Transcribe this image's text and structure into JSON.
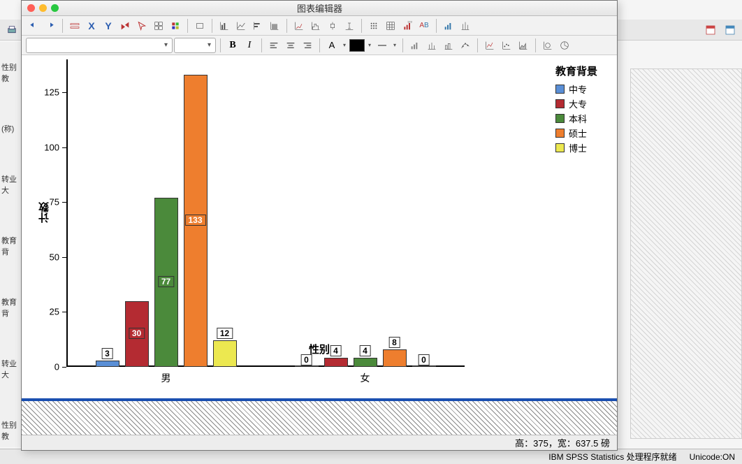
{
  "window_title": "图表编辑器",
  "bg_side_items": [
    "性别 教",
    "(称)",
    "转业大",
    "教育背",
    "教育背",
    "转业大",
    "性别 教"
  ],
  "bg_status": {
    "ready": "IBM SPSS Statistics 处理程序就绪",
    "unicode": "Unicode:ON"
  },
  "dim_text": "高：375，宽：637.5 磅",
  "toolbar": {
    "X": "X",
    "Y": "Y",
    "B": "B",
    "I": "I",
    "A": "A"
  },
  "chart_data": {
    "type": "bar",
    "title": "",
    "xlabel": "性别",
    "ylabel": "计数",
    "legend_title": "教育背景",
    "categories": [
      "男",
      "女"
    ],
    "series": [
      {
        "name": "中专",
        "color": "#5a8fd6",
        "values": [
          3,
          0
        ]
      },
      {
        "name": "大专",
        "color": "#b42b32",
        "values": [
          30,
          4
        ]
      },
      {
        "name": "本科",
        "color": "#4b8a3b",
        "values": [
          77,
          4
        ]
      },
      {
        "name": "硕士",
        "color": "#ee7e2e",
        "values": [
          133,
          8
        ]
      },
      {
        "name": "博士",
        "color": "#ece850",
        "values": [
          12,
          0
        ]
      }
    ],
    "y_ticks": [
      0,
      25,
      50,
      75,
      100,
      125
    ],
    "ylim": [
      0,
      140
    ]
  }
}
